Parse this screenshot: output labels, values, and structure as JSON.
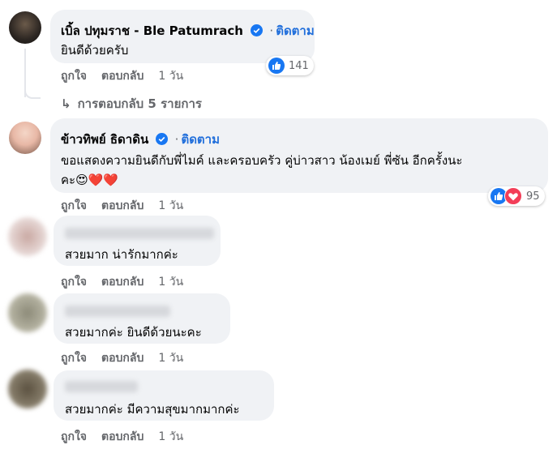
{
  "comments": [
    {
      "author": "เบิ้ล ปทุมราช - Ble Patumrach",
      "follow": "ติดตาม",
      "text": "ยินดีด้วยครับ",
      "like_label": "ถูกใจ",
      "reply_label": "ตอบกลับ",
      "time": "1 วัน",
      "reaction_count": "141",
      "replies_link": "การตอบกลับ 5 รายการ"
    },
    {
      "author": "ข้าวทิพย์ ธิดาดิน",
      "follow": "ติดตาม",
      "text_line1": "ขอแสดงความยินดีกับพี่ไมค์ และครอบครัว คู่บ่าวสาว น้องเมย์ พี่ซัน อีกครั้งนะ",
      "text_line2": "คะ😍❤️❤️",
      "like_label": "ถูกใจ",
      "reply_label": "ตอบกลับ",
      "time": "1 วัน",
      "reaction_count": "95"
    },
    {
      "text": "สวยมาก น่ารักมากค่ะ",
      "like_label": "ถูกใจ",
      "reply_label": "ตอบกลับ",
      "time": "1 วัน"
    },
    {
      "text": "สวยมากค่ะ ยินดีด้วยนะคะ",
      "like_label": "ถูกใจ",
      "reply_label": "ตอบกลับ",
      "time": "1 วัน"
    },
    {
      "text": "สวยมากค่ะ มีความสุขมากมากค่ะ",
      "like_label": "ถูกใจ",
      "reply_label": "ตอบกลับ",
      "time": "1 วัน"
    }
  ],
  "colors": {
    "bubble": "#f0f2f5",
    "link_blue": "#216fdb",
    "like_blue": "#1877f2",
    "love_red": "#f33e58",
    "meta_gray": "#65676b"
  },
  "icons": [
    "verified-badge-icon",
    "like-reaction-icon",
    "love-reaction-icon",
    "reply-arrow-icon"
  ]
}
